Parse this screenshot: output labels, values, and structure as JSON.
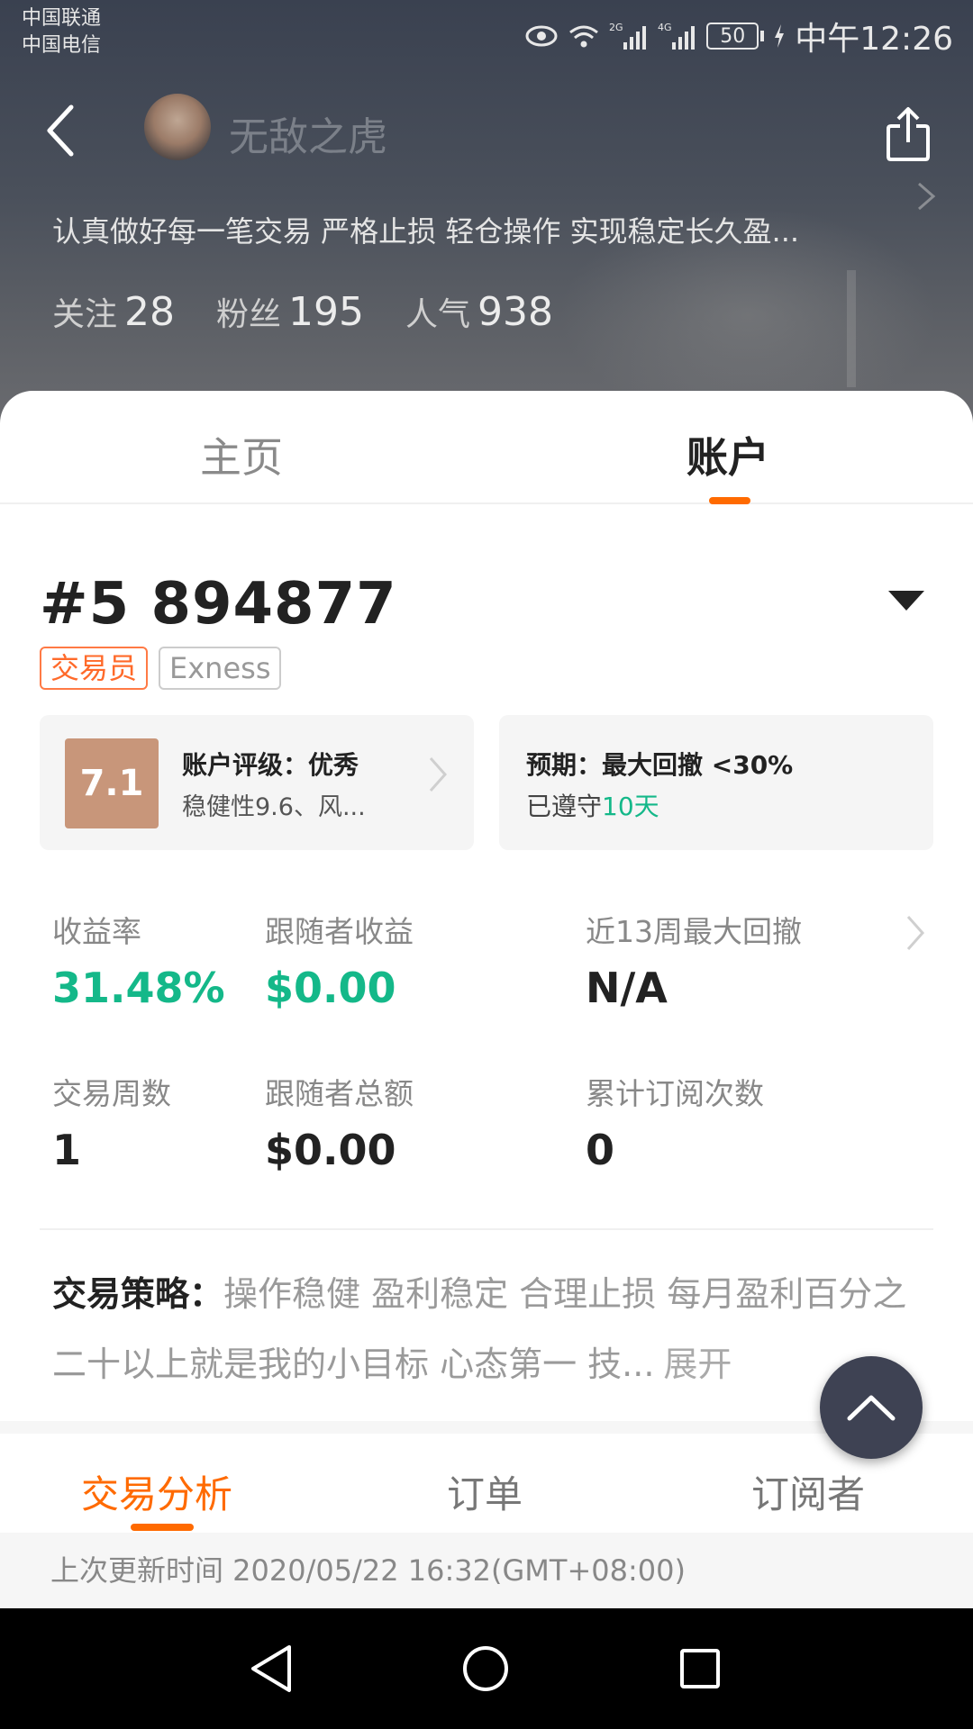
{
  "status_bar": {
    "carrier_1": "中国联通",
    "carrier_2": "中国电信",
    "net_1": "2G",
    "net_2": "4G",
    "battery": "50",
    "time": "中午12:26"
  },
  "header": {
    "nickname": "无敌之虎",
    "bio": "认真做好每一笔交易 严格止损 轻仓操作 实现稳定长久盈...",
    "stats": [
      {
        "label": "关注",
        "value": "28"
      },
      {
        "label": "粉丝",
        "value": "195"
      },
      {
        "label": "人气",
        "value": "938"
      }
    ]
  },
  "tabs": {
    "home": "主页",
    "account": "账户"
  },
  "account": {
    "number": "#5 894877",
    "tags": [
      "交易员",
      "Exness"
    ],
    "rating": {
      "score": "7.1",
      "title": "账户评级：优秀",
      "subtitle": "稳健性9.6、风..."
    },
    "expectation": {
      "title": "预期：最大回撤 <30%",
      "kept_prefix": "已遵守",
      "kept_days": "10天"
    },
    "metrics": [
      {
        "label": "收益率",
        "value": "31.48%"
      },
      {
        "label": "跟随者收益",
        "value": "$0.00"
      },
      {
        "label": "近13周最大回撤",
        "value": "N/A"
      },
      {
        "label": "交易周数",
        "value": "1"
      },
      {
        "label": "跟随者总额",
        "value": "$0.00"
      },
      {
        "label": "累计订阅次数",
        "value": "0"
      }
    ],
    "strategy": {
      "heading": "交易策略：",
      "text": "操作稳健 盈利稳定 合理止损 每月盈利百分之二十以上就是我的小目标 心态第一 技...",
      "expand": "展开"
    }
  },
  "subtabs": {
    "analysis": "交易分析",
    "orders": "订单",
    "subscribers": "订阅者"
  },
  "updated": "上次更新时间 2020/05/22 16:32(GMT+08:00)",
  "colors": {
    "accent": "#ff6a00",
    "positive": "#14b889",
    "score_bg": "#c8967a"
  }
}
